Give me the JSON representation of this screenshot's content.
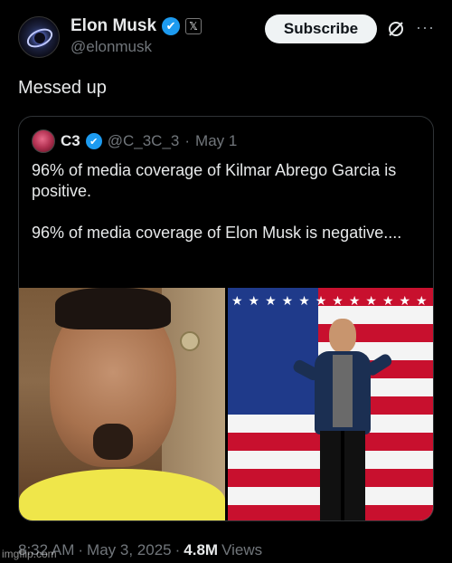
{
  "author": {
    "display_name": "Elon Musk",
    "handle": "@elonmusk",
    "verified_icon": "✔",
    "x_badge": "𝕏"
  },
  "header": {
    "subscribe_label": "Subscribe",
    "more_label": "···"
  },
  "tweet": {
    "text": "Messed up"
  },
  "quote": {
    "name": "C3",
    "verified_icon": "✔",
    "handle": "@C_3C_3",
    "dot": "·",
    "date": "May 1",
    "paragraph1": "96% of media coverage of Kilmar Abrego Garcia is positive.",
    "paragraph2": "96% of media coverage of Elon Musk is negative...."
  },
  "footer": {
    "time": "8:32 AM",
    "sep1": "·",
    "date": "May 3, 2025",
    "sep2": "·",
    "views_count": "4.8M",
    "views_label": "Views"
  },
  "watermark": "imgflip.com",
  "colors": {
    "accent": "#1d9bf0",
    "background": "#000000",
    "text_primary": "#e7e9ea",
    "text_secondary": "#71767b"
  }
}
